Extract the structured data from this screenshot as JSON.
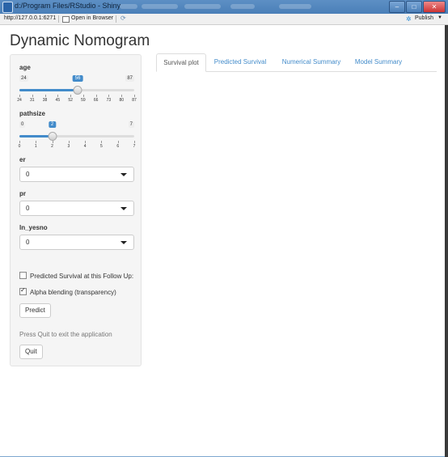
{
  "window": {
    "title": "d:/Program Files/RStudio - Shiny",
    "controls": {
      "minimize": "–",
      "maximize": "□",
      "close": "✕"
    }
  },
  "toolbar": {
    "url": "http://127.0.0.1:6271",
    "open_in_browser": "Open in Browser",
    "publish": "Publish"
  },
  "app": {
    "title": "Dynamic Nomogram"
  },
  "sidebar": {
    "age": {
      "label": "age",
      "min": 24,
      "max": 87,
      "value": 56,
      "ticks": [
        "24",
        "31",
        "38",
        "45",
        "52",
        "59",
        "66",
        "73",
        "80",
        "87"
      ]
    },
    "pathsize": {
      "label": "pathsize",
      "min": 0,
      "max": 7,
      "value": 2,
      "ticks": [
        "0",
        "1",
        "2",
        "3",
        "4",
        "5",
        "6",
        "7"
      ]
    },
    "er": {
      "label": "er",
      "value": "0"
    },
    "pr": {
      "label": "pr",
      "value": "0"
    },
    "ln_yesno": {
      "label": "ln_yesno",
      "value": "0"
    },
    "predicted_survival_check": {
      "label": "Predicted Survival at this Follow Up:",
      "checked": false
    },
    "alpha_check": {
      "label": "Alpha blending (transparency)",
      "checked": true
    },
    "predict_button": "Predict",
    "quit_note": "Press Quit to exit the application",
    "quit_button": "Quit"
  },
  "tabs": [
    {
      "label": "Survival plot",
      "active": true
    },
    {
      "label": "Predicted Survival",
      "active": false
    },
    {
      "label": "Numerical Summary",
      "active": false
    },
    {
      "label": "Model Summary",
      "active": false
    }
  ]
}
